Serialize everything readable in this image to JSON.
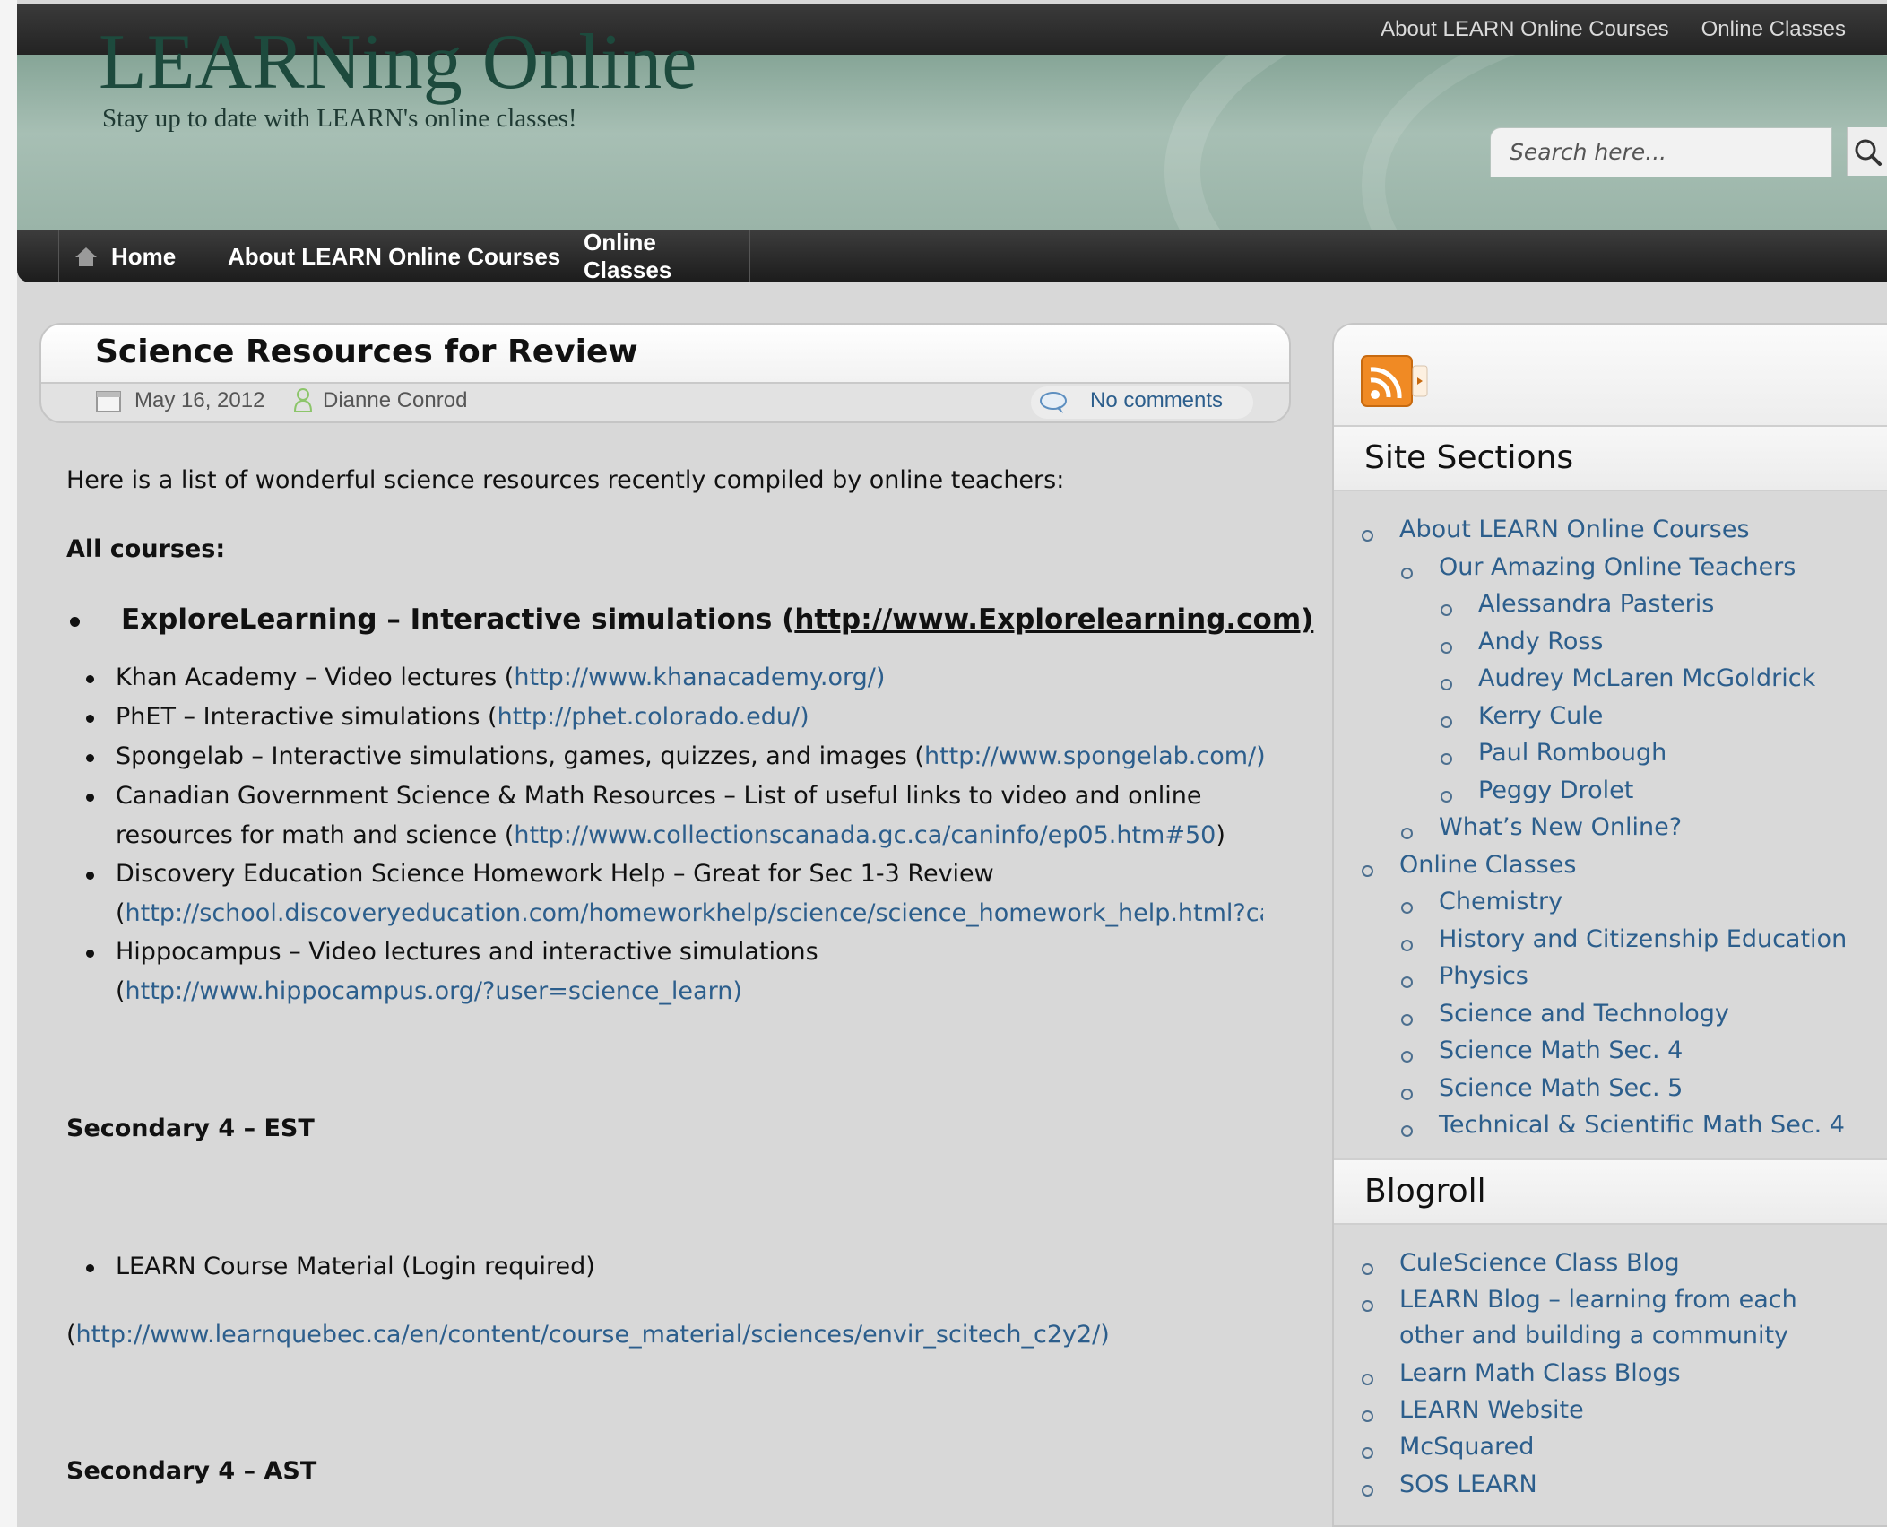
{
  "top_links": [
    "About LEARN Online Courses",
    "Online Classes"
  ],
  "site": {
    "title": "LEARNing Online",
    "description": "Stay up to date with LEARN's online classes!"
  },
  "search": {
    "placeholder": "Search here..."
  },
  "nav": {
    "home": "Home",
    "about": "About LEARN Online Courses",
    "classes": "Online Classes"
  },
  "post": {
    "title": "Science Resources for Review",
    "date": "May 16, 2012",
    "author": "Dianne Conrod",
    "comments": "No comments",
    "intro": "Here is a list of wonderful science resources recently compiled by online teachers:",
    "all_courses": "All courses:",
    "featured": {
      "text": "ExploreLearning – Interactive simulations (",
      "link": "http://www.Explorelearning.com)"
    },
    "resources": [
      {
        "pre": "Khan Academy – Video lectures (",
        "link": "http://www.khanacademy.org/)",
        "post": ""
      },
      {
        "pre": "PhET – Interactive simulations (",
        "link": "http://phet.colorado.edu/)",
        "post": ""
      },
      {
        "pre": "Spongelab – Interactive simulations, games, quizzes, and images (",
        "link": "http://www.spongelab.com/)",
        "post": ""
      },
      {
        "line1": "Canadian Government Science & Math Resources – List of useful links to video and online",
        "pre": "resources for math and science (",
        "link": "http://www.collectionscanada.gc.ca/caninfo/ep05.htm#50",
        "post": ")"
      },
      {
        "line1": "Discovery Education Science Homework Help – Great for Sec 1-3 Review",
        "pre": "(",
        "link": "http://school.discoveryeducation.com/homeworkhelp/science/science_homework_help.html?cam",
        "post": ""
      },
      {
        "line1": "Hippocampus – Video lectures and interactive simulations",
        "pre": "(",
        "link": "http://www.hippocampus.org/?user=science_learn)",
        "post": ""
      }
    ],
    "sec4_est": "Secondary 4 – EST",
    "learn_material": "LEARN Course Material (Login required)",
    "learn_link_pre": "(",
    "learn_link": "http://www.learnquebec.ca/en/content/course_material/sciences/envir_scitech_c2y2/)",
    "sec4_ast": "Secondary 4 – AST"
  },
  "sidebar": {
    "site_sections_title": "Site Sections",
    "site_sections": [
      {
        "label": "About LEARN Online Courses",
        "level": 0
      },
      {
        "label": "Our Amazing Online Teachers",
        "level": 1
      },
      {
        "label": "Alessandra Pasteris",
        "level": 2
      },
      {
        "label": "Andy Ross",
        "level": 2
      },
      {
        "label": "Audrey McLaren McGoldrick",
        "level": 2
      },
      {
        "label": "Kerry Cule",
        "level": 2
      },
      {
        "label": "Paul Rombough",
        "level": 2
      },
      {
        "label": "Peggy Drolet",
        "level": 2
      },
      {
        "label": "What’s New Online?",
        "level": 1
      },
      {
        "label": "Online Classes",
        "level": 0
      },
      {
        "label": "Chemistry",
        "level": 1
      },
      {
        "label": "History and Citizenship Education",
        "level": 1
      },
      {
        "label": "Physics",
        "level": 1
      },
      {
        "label": "Science and Technology",
        "level": 1
      },
      {
        "label": "Science Math Sec. 4",
        "level": 1
      },
      {
        "label": "Science Math Sec. 5",
        "level": 1
      },
      {
        "label": "Technical & Scientific Math Sec. 4",
        "level": 1
      }
    ],
    "blogroll_title": "Blogroll",
    "blogroll": [
      "CuleScience Class Blog",
      "LEARN Blog – learning from each",
      "other and building a community",
      "Learn Math Class Blogs",
      "LEARN Website",
      "McSquared",
      "SOS LEARN"
    ]
  },
  "colors": {
    "link": "#2c5e8c",
    "header_green": "#1d4a3d",
    "rss_orange": "#f08a24"
  },
  "icons": [
    "home-icon",
    "search-icon",
    "calendar-icon",
    "author-icon",
    "comment-icon",
    "rss-icon"
  ]
}
